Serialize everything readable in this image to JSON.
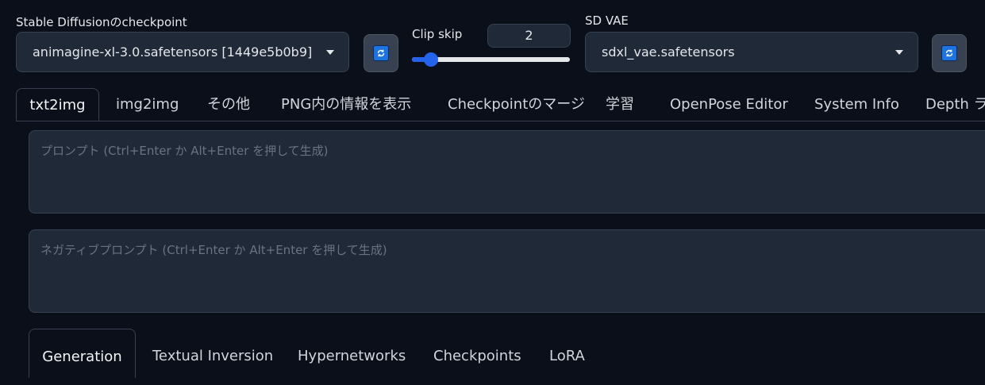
{
  "checkpoint": {
    "label": "Stable Diffusionのcheckpoint",
    "value": "animagine-xl-3.0.safetensors [1449e5b0b9]"
  },
  "clip_skip": {
    "label": "Clip skip",
    "value": "2",
    "slider_fraction": 0.12
  },
  "vae": {
    "label": "SD VAE",
    "value": "sdxl_vae.safetensors"
  },
  "tabs": [
    {
      "label": "txt2img"
    },
    {
      "label": "img2img"
    },
    {
      "label": "その他"
    },
    {
      "label": "PNG内の情報を表示"
    },
    {
      "label": "Checkpointのマージ"
    },
    {
      "label": "学習"
    },
    {
      "label": "OpenPose Editor"
    },
    {
      "label": "System Info"
    },
    {
      "label": "Depth ライ"
    }
  ],
  "prompt": {
    "placeholder": "プロンプト (Ctrl+Enter か Alt+Enter を押して生成)"
  },
  "negative_prompt": {
    "placeholder": "ネガティブプロンプト (Ctrl+Enter か Alt+Enter を押して生成)"
  },
  "subtabs": [
    {
      "label": "Generation"
    },
    {
      "label": "Textual Inversion"
    },
    {
      "label": "Hypernetworks"
    },
    {
      "label": "Checkpoints"
    },
    {
      "label": "LoRA"
    }
  ],
  "colors": {
    "background": "#0b0f19",
    "panel": "#1f2937",
    "accent": "#2563eb"
  },
  "icons": {
    "refresh": "refresh-icon",
    "dropdown": "chevron-down-icon"
  }
}
